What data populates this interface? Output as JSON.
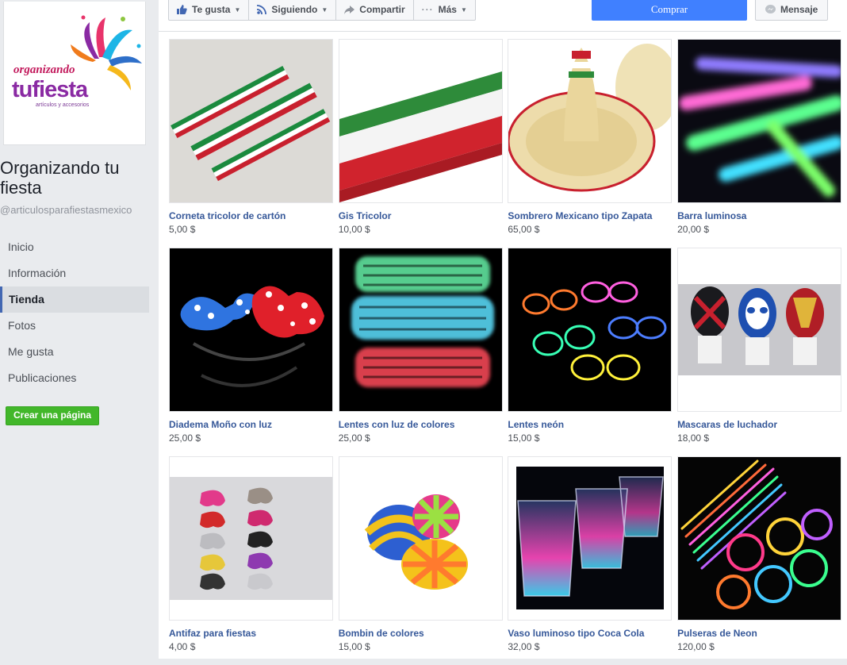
{
  "sidebar": {
    "logo": {
      "line1": "organizando",
      "line2": "tufiesta",
      "tagline": "artículos y accesorios"
    },
    "page_name": "Organizando tu fiesta",
    "handle": "@articulosparafiestasmexico",
    "nav": [
      {
        "label": "Inicio"
      },
      {
        "label": "Información"
      },
      {
        "label": "Tienda",
        "active": true
      },
      {
        "label": "Fotos"
      },
      {
        "label": "Me gusta"
      },
      {
        "label": "Publicaciones"
      }
    ],
    "create_page_label": "Crear una página"
  },
  "actionbar": {
    "like_label": "Te gusta",
    "following_label": "Siguiendo",
    "share_label": "Compartir",
    "more_label": "Más",
    "buy_label": "Comprar",
    "message_label": "Mensaje"
  },
  "colors": {
    "link": "#365899",
    "accent": "#4080ff",
    "create_green": "#42b72a"
  },
  "products": [
    {
      "name": "Corneta tricolor de cartón",
      "price": "5,00 $",
      "image": "tricolor-horns"
    },
    {
      "name": "Gis Tricolor",
      "price": "10,00 $",
      "image": "tricolor-chalk"
    },
    {
      "name": "Sombrero Mexicano tipo Zapata",
      "price": "65,00 $",
      "image": "sombrero"
    },
    {
      "name": "Barra luminosa",
      "price": "20,00 $",
      "image": "glow-sticks"
    },
    {
      "name": "Diadema Moño con luz",
      "price": "25,00 $",
      "image": "bow-headband"
    },
    {
      "name": "Lentes con luz de colores",
      "price": "25,00 $",
      "image": "led-glasses"
    },
    {
      "name": "Lentes neón",
      "price": "15,00 $",
      "image": "neon-glasses"
    },
    {
      "name": "Mascaras de luchador",
      "price": "18,00 $",
      "image": "wrestler-masks"
    },
    {
      "name": "Antifaz para fiestas",
      "price": "4,00 $",
      "image": "party-masks"
    },
    {
      "name": "Bombin de colores",
      "price": "15,00 $",
      "image": "color-hats"
    },
    {
      "name": "Vaso luminoso tipo Coca Cola",
      "price": "32,00 $",
      "image": "glow-cups"
    },
    {
      "name": "Pulseras de Neon",
      "price": "120,00 $",
      "image": "neon-bracelets"
    }
  ]
}
